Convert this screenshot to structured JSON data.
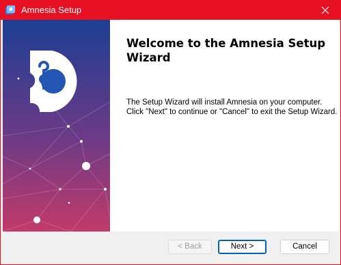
{
  "window": {
    "title": "Amnesia Setup",
    "close_symbol": "✕"
  },
  "banner": {
    "icon": "puzzle-logo-icon",
    "background_top": "#1d3e94",
    "background_bottom": "#c23a6a"
  },
  "main": {
    "heading": "Welcome to the Amnesia Setup Wizard",
    "body_line1": "The Setup Wizard will install Amnesia on your computer.",
    "body_line2": "Click \"Next\" to continue or \"Cancel\" to exit the Setup Wizard."
  },
  "buttons": {
    "back_label": "< Back",
    "next_label": "Next >",
    "cancel_label": "Cancel"
  },
  "colors": {
    "titlebar": "#e81123",
    "focus_border": "#005fb8"
  }
}
